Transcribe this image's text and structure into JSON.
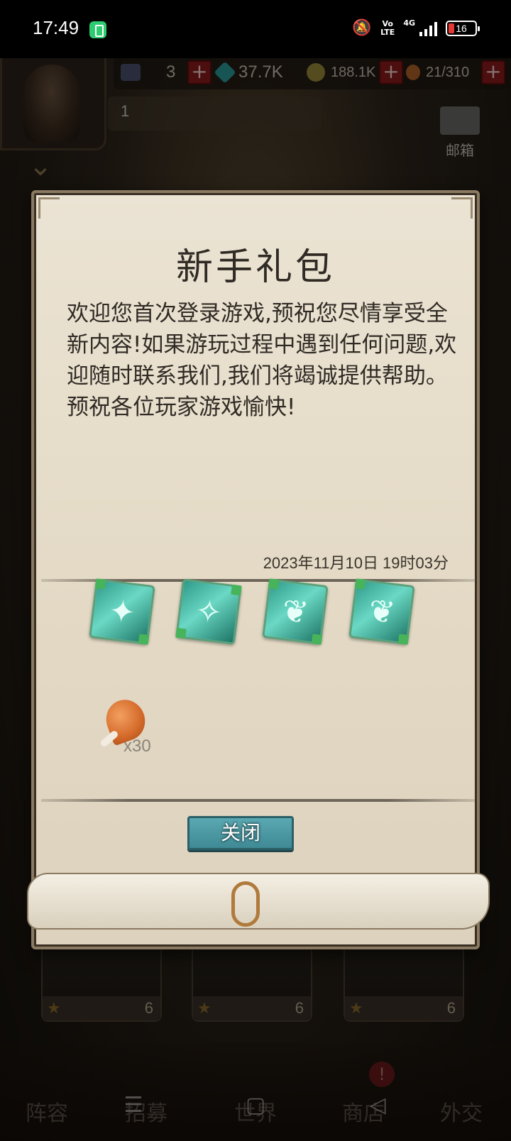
{
  "status_bar": {
    "time": "17:49",
    "volte": "Vo\nLTE",
    "network": "4G",
    "battery": "16",
    "mute_icon": "bell-off-icon"
  },
  "hud": {
    "player_level": "1",
    "energy": "3",
    "gems": "37.7K",
    "gold": "188.1K",
    "stamina": "21/310",
    "mail_label": "邮箱",
    "plus": "+"
  },
  "dialog": {
    "title": "新手礼包",
    "body": "欢迎您首次登录游戏,预祝您尽情享受全新内容!如果游玩过程中遇到任何问题,欢迎随时联系我们,我们将竭诚提供帮助。预祝各位玩家游戏愉快!",
    "date": "2023年11月10日 19时03分",
    "rewards": [
      "green-shard-icon",
      "green-shard-icon",
      "green-feather-icon",
      "green-feather-icon"
    ],
    "food_count": "x30",
    "close_label": "关闭"
  },
  "cards": [
    {
      "count": "6"
    },
    {
      "count": "6"
    },
    {
      "count": "6"
    }
  ],
  "nav": {
    "items": [
      "阵容",
      "招募",
      "世界",
      "商店",
      "外交"
    ]
  }
}
